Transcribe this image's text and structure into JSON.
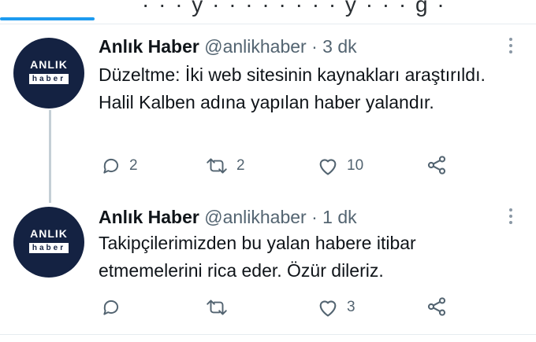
{
  "top": {
    "cut_text": "· · · y · · · · · · · · y · · · g ·"
  },
  "tweets": [
    {
      "avatar": {
        "line1": "ANLIK",
        "line2": "haber"
      },
      "name": "Anlık Haber",
      "handle": "@anlikhaber",
      "separator": "·",
      "time": "3 dk",
      "text": "Düzeltme: İki web sitesinin kaynakları araştırıldı. Halil Kalben adına yapılan haber yalandır.",
      "replies": "2",
      "retweets": "2",
      "likes": "10"
    },
    {
      "avatar": {
        "line1": "ANLIK",
        "line2": "haber"
      },
      "name": "Anlık Haber",
      "handle": "@anlikhaber",
      "separator": "·",
      "time": "1 dk",
      "text": "Takipçilerimizden bu yalan habere itibar etmemelerini rica eder. Özür dileriz.",
      "replies": "",
      "retweets": "",
      "likes": "3"
    }
  ],
  "colors": {
    "accent": "#1d9bf0",
    "avatar_bg": "#142242",
    "muted": "#536471"
  }
}
